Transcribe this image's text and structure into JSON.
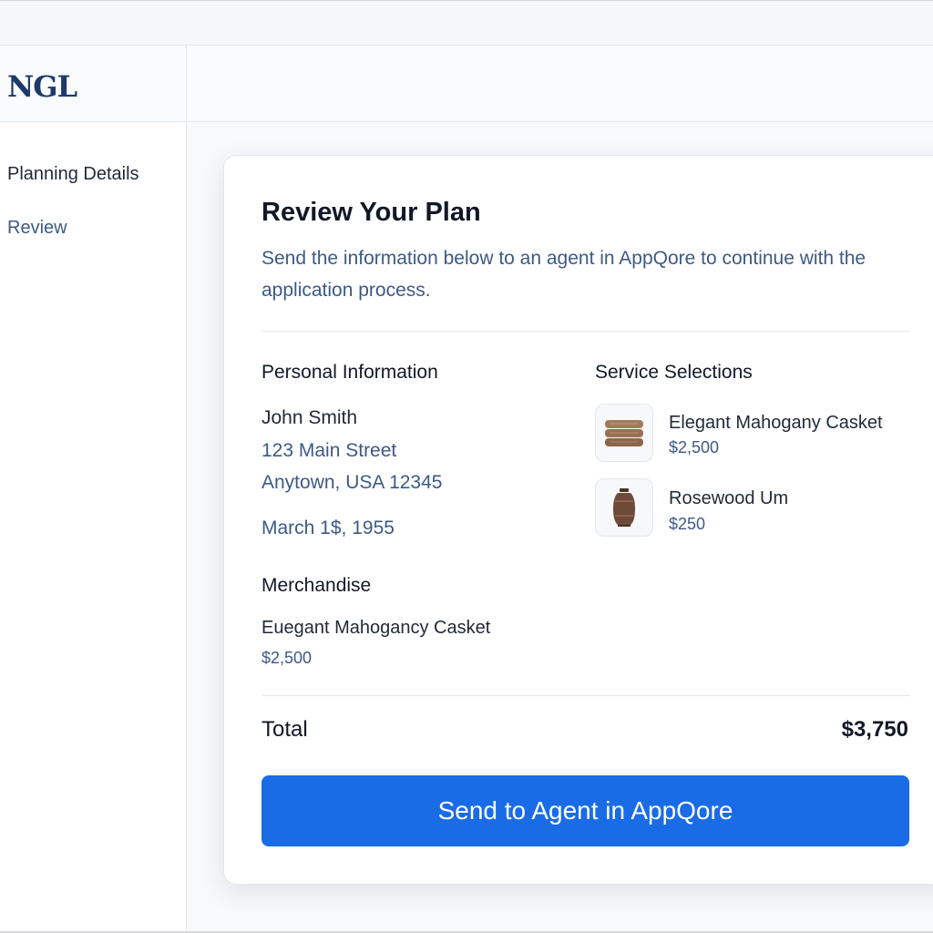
{
  "app": {
    "logo_text": "NGL"
  },
  "sidebar": {
    "items": [
      {
        "label": "Planning Details"
      },
      {
        "label": "Review"
      }
    ]
  },
  "review": {
    "title": "Review Your Plan",
    "description": "Send the information below to an agent in AppQore to continue with the application process.",
    "personal_info": {
      "heading": "Personal Information",
      "name": "John Smith",
      "address_line1": "123 Main Street",
      "address_line2": "Anytown, USA 12345",
      "birth_date": "March 1$, 1955"
    },
    "service_selections": {
      "heading": "Service Selections",
      "items": [
        {
          "name": "Elegant Mahogany Casket",
          "price": "$2,500",
          "icon": "casket-icon"
        },
        {
          "name": "Rosewood Um",
          "price": "$250",
          "icon": "urn-icon"
        }
      ]
    },
    "merchandise": {
      "heading": "Merchandise",
      "item_name": "Euegant Mahogancy Casket",
      "item_price": "$2,500"
    },
    "total": {
      "label": "Total",
      "value": "$3,750"
    },
    "send_button_label": "Send to Agent in AppQore"
  },
  "colors": {
    "accent": "#1a6be6",
    "logo": "#1c3a6b",
    "secondary_text": "#3c5a85"
  }
}
